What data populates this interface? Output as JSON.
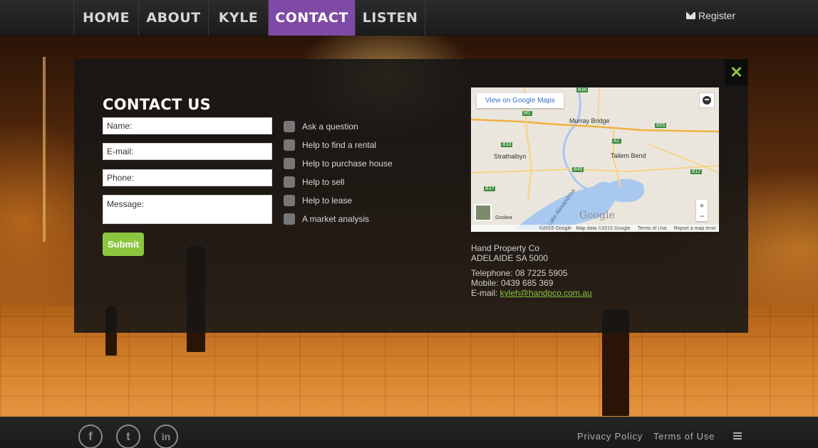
{
  "nav": {
    "items": [
      {
        "label": "HOME"
      },
      {
        "label": "ABOUT"
      },
      {
        "label": "KYLE"
      },
      {
        "label": "CONTACT"
      },
      {
        "label": "LISTEN"
      }
    ],
    "active": "CONTACT",
    "register_label": "Register"
  },
  "modal": {
    "close_symbol": "✕",
    "title": "CONTACT US",
    "form": {
      "name_placeholder": "Name:",
      "email_placeholder": "E-mail:",
      "phone_placeholder": "Phone:",
      "message_placeholder": "Message:",
      "submit_label": "Submit"
    },
    "options": [
      {
        "label": "Ask a question"
      },
      {
        "label": "Help to find a rental"
      },
      {
        "label": "Help to purchase house"
      },
      {
        "label": "Help to sell"
      },
      {
        "label": "Help to lease"
      },
      {
        "label": "A market analysis"
      }
    ],
    "map": {
      "link_label": "View on Google Maps",
      "places": [
        "Murray Bridge",
        "Strathalbyn",
        "Tailem Bend",
        "Lake Alexandrina",
        "Goolwa"
      ],
      "roads": [
        "B36",
        "M1",
        "B33",
        "B55",
        "A1",
        "B45",
        "B12",
        "B37"
      ],
      "google_logo": "Google",
      "zoom_in": "+",
      "zoom_out": "−",
      "footer": {
        "copyright": "©2015 Google · Map data ©2015 Google",
        "terms": "Terms of Use",
        "report": "Report a map error"
      }
    },
    "company": {
      "name": "Hand Property Co",
      "address": "ADELAIDE SA 5000"
    },
    "contact": {
      "telephone_label": "Telephone: ",
      "telephone": "08 7225 5905",
      "mobile_label": "Mobile: ",
      "mobile": "0439 685 369",
      "email_label": "E-mail: ",
      "email": "kyleh@handpco.com.au"
    }
  },
  "footer": {
    "social": [
      {
        "name": "facebook-icon",
        "glyph": "f"
      },
      {
        "name": "twitter-icon",
        "glyph": "t"
      },
      {
        "name": "linkedin-icon",
        "glyph": "in"
      }
    ],
    "privacy_label": "Privacy Policy",
    "terms_label": "Terms of Use"
  },
  "colors": {
    "accent_green": "#8cc63f",
    "active_purple": "#7e4aa6"
  }
}
